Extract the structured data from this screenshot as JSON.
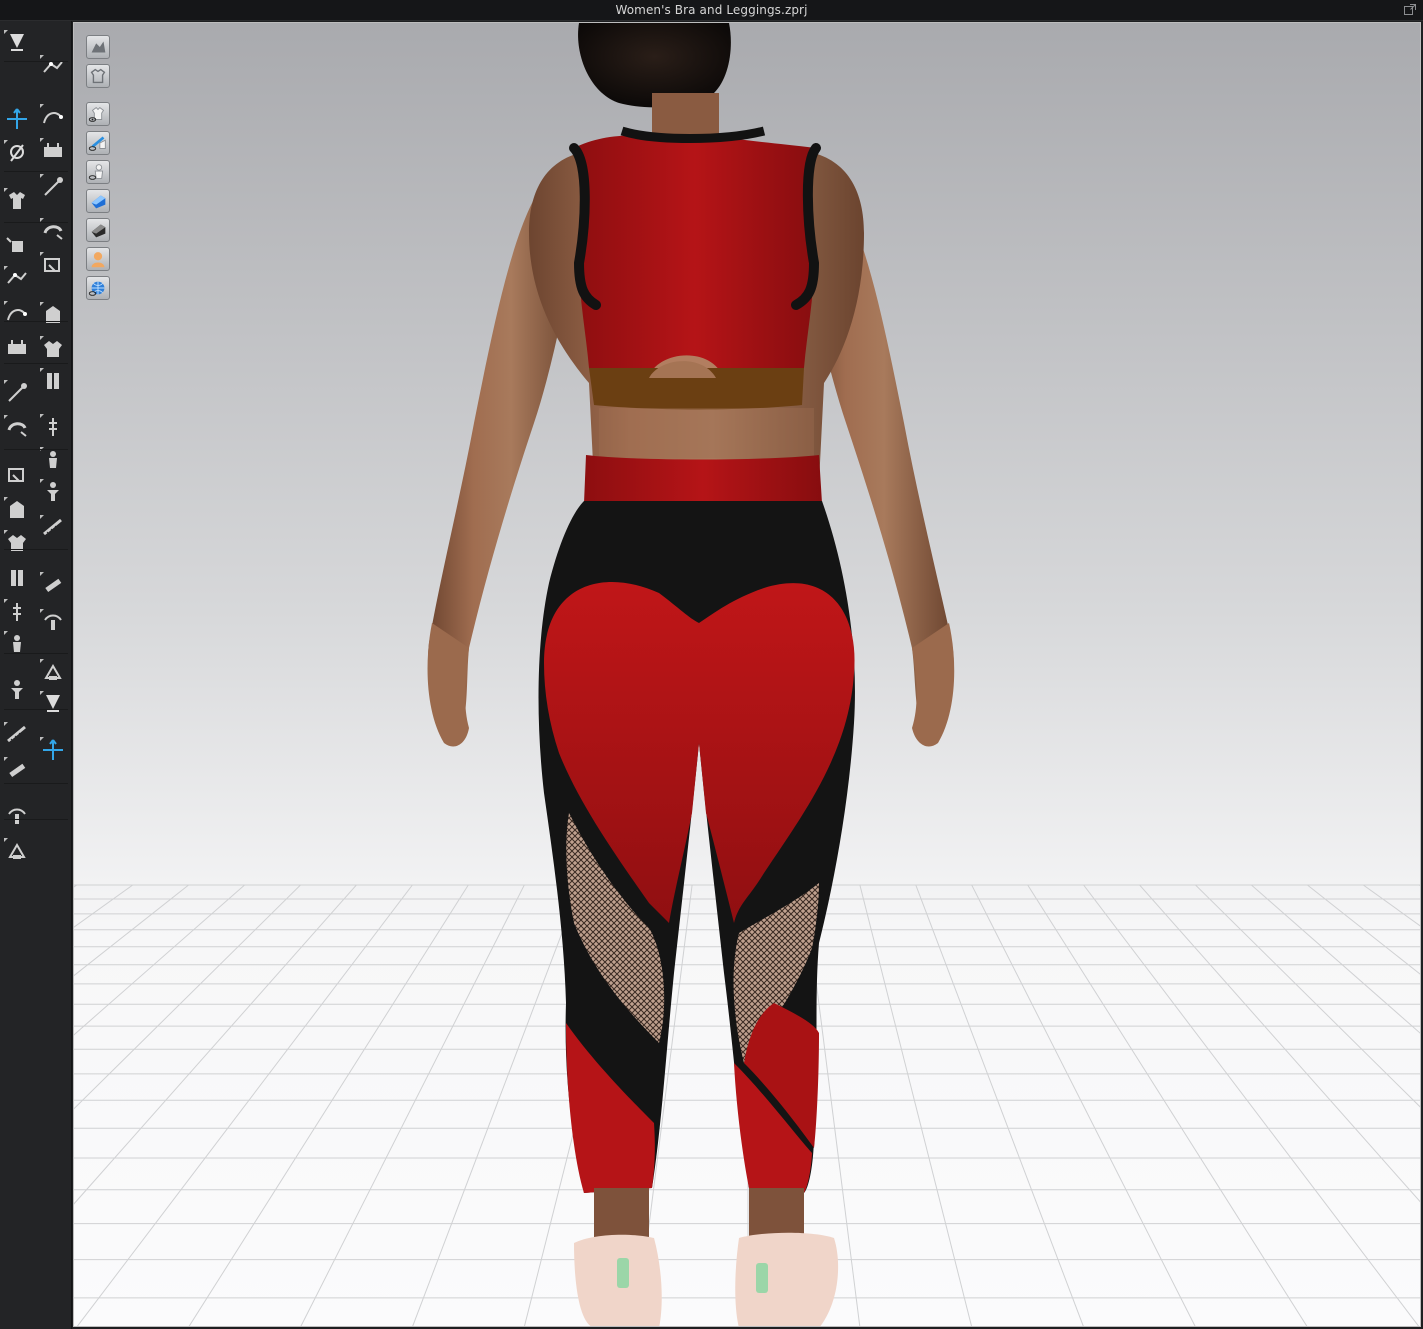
{
  "window": {
    "title": "Women's Bra and Leggings.zprj",
    "expand_icon": "expand-window-icon"
  },
  "toolbar": {
    "col_a": [
      "simulation-drop-icon",
      "select-move-icon",
      "fold-arrange-icon",
      "show-garment-icon",
      "transform-pattern-icon",
      "edit-point-icon",
      "edit-curvature-icon",
      "tack-icon",
      "pin-icon",
      "brush-icon",
      "reset-2d-icon",
      "arrange-avatar-icon",
      "fold-garment-icon",
      "fit-garment-icon",
      "zip-garment-icon",
      "avatar-size-icon",
      "avatar-pose-icon",
      "measure-icon",
      "ruler-icon",
      "tape-icon",
      "hanger-icon"
    ],
    "col_b": [
      "walk-animation-icon",
      "steam-icon",
      "strengthen-icon",
      "fix-pin-icon",
      "trim-icon",
      "edit-trim-icon",
      "ruler-curve-icon",
      "graphic-icon",
      "texture-icon",
      "button-icon",
      "buttonhole-icon",
      "gather-icon",
      "lock-button-icon",
      "zipper-icon",
      "puckering-icon",
      "shade-solid-icon",
      "shade-grey-icon",
      "tack-arrows-icon"
    ]
  },
  "viewport_toolbar": {
    "buttons": [
      "avatar-display-icon",
      "garment-display-icon",
      "show-garment-eye-icon",
      "show-internal-lines-eye-icon",
      "show-avatar-eye-icon",
      "texture-surface-icon",
      "shaded-surface-icon",
      "skin-avatar-icon",
      "mesh-display-icon"
    ]
  },
  "scene": {
    "background_top": "#aaabaf",
    "background_bottom": "#fbfbfc",
    "grid_color": "#d3d4d6",
    "garment_red": "#b81316",
    "garment_black": "#141414",
    "waist_band_brown": "#6b3f12",
    "skin": "#a57454"
  }
}
